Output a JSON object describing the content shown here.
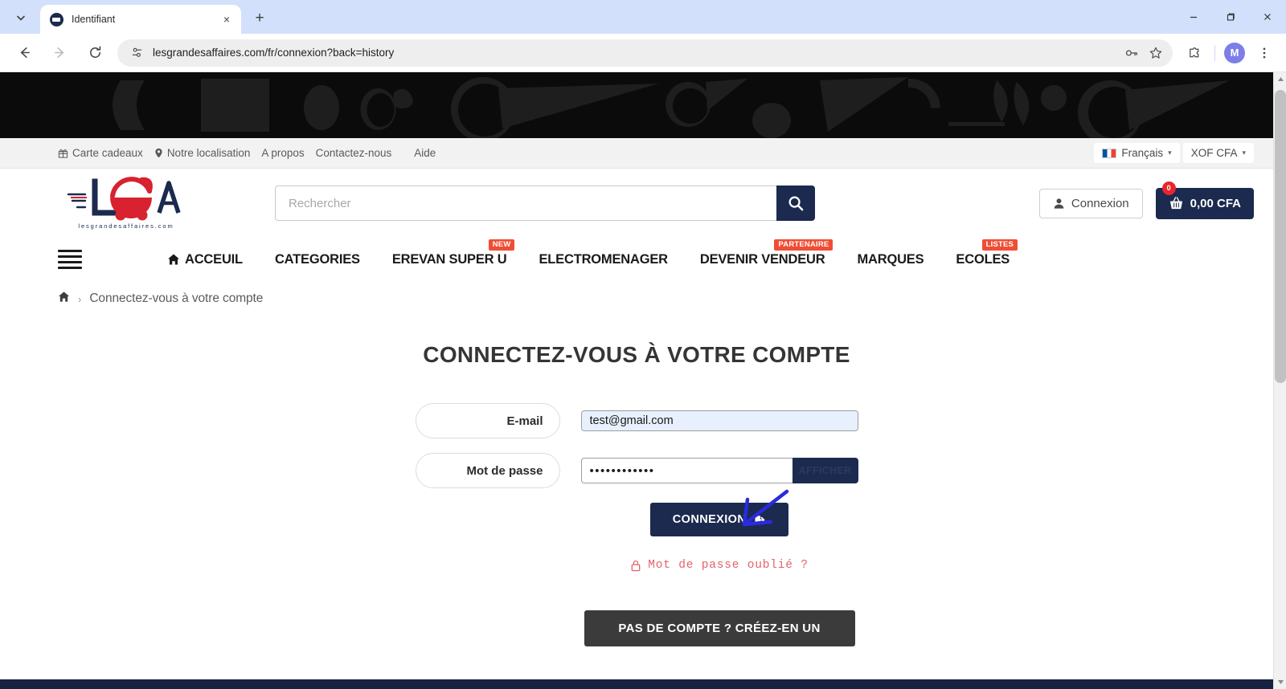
{
  "browser": {
    "tab": {
      "title": "Identifiant",
      "favicon": "globe-icon",
      "close": "×"
    },
    "new_tab_label": "+",
    "url": "lesgrandesaffaires.com/fr/connexion?back=history",
    "profile_initial": "M",
    "window": {
      "minimize": "−",
      "maximize": "❐",
      "close": "✕"
    }
  },
  "topbar": {
    "links": [
      {
        "label": "Carte cadeaux",
        "icon": "gift-icon"
      },
      {
        "label": "Notre localisation",
        "icon": "map-pin-icon"
      },
      {
        "label": "A propos",
        "icon": ""
      },
      {
        "label": "Contactez-nous",
        "icon": ""
      },
      {
        "label": "Aide",
        "icon": ""
      }
    ],
    "language": "Français",
    "currency": "XOF CFA"
  },
  "header": {
    "logo_text": "LGA",
    "logo_caption": "lesgrandesaffaires.com",
    "search_placeholder": "Rechercher",
    "search_value": "",
    "login_label": "Connexion",
    "cart_amount": "0,00 CFA",
    "cart_count": "0"
  },
  "nav": {
    "items": [
      {
        "label": "ACCEUIL",
        "icon": "home-icon",
        "badge": ""
      },
      {
        "label": "CATEGORIES",
        "icon": "",
        "badge": ""
      },
      {
        "label": "EREVAN SUPER U",
        "icon": "",
        "badge": "NEW"
      },
      {
        "label": "ELECTROMENAGER",
        "icon": "",
        "badge": ""
      },
      {
        "label": "DEVENIR VENDEUR",
        "icon": "",
        "badge": "PARTENAIRE"
      },
      {
        "label": "MARQUES",
        "icon": "",
        "badge": ""
      },
      {
        "label": "ECOLES",
        "icon": "",
        "badge": "LISTES"
      }
    ]
  },
  "breadcrumb": {
    "home_icon": "home-icon",
    "separator": "›",
    "current": "Connectez-vous à votre compte"
  },
  "main": {
    "title": "CONNECTEZ-VOUS À VOTRE COMPTE",
    "email_label": "E-mail",
    "email_value": "test@gmail.com",
    "password_label": "Mot de passe",
    "password_value": "••••••••••••",
    "password_toggle": "AFFICHER",
    "submit_label": "CONNEXION",
    "submit_icon": "sign-in-icon",
    "forgot_label": "Mot de passe oublié ?",
    "forgot_icon": "lock-icon",
    "create_account_label": "PAS DE COMPTE ? CRÉEZ-EN UN"
  },
  "colors": {
    "brand_navy": "#1b2a4e",
    "brand_red": "#e8262d",
    "badge_orange": "#f04d34",
    "link_red": "#e4626b",
    "create_gray": "#3b3b3b",
    "annotation_blue": "#2a2adf"
  }
}
